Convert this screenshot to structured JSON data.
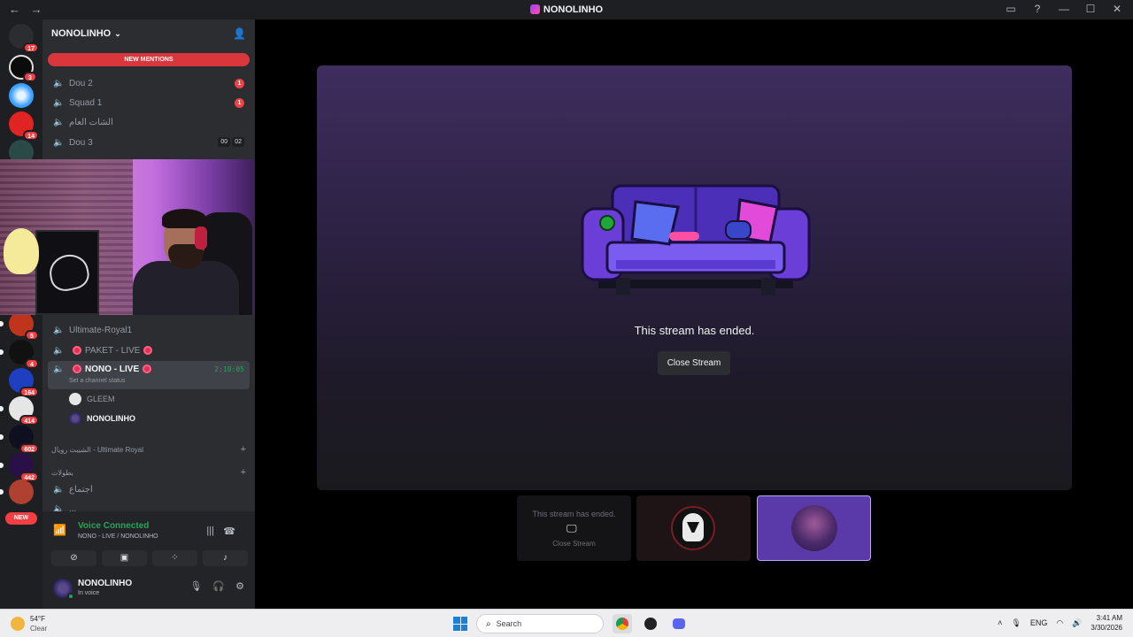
{
  "window": {
    "title": "NONOLINHO",
    "nav_back": "←",
    "nav_forward": "→",
    "icons": [
      "inbox-icon",
      "help-icon",
      "minimize-icon",
      "maximize-icon",
      "close-icon"
    ],
    "control_glyphs": [
      "▭",
      "?",
      "—",
      "☐",
      "✕"
    ]
  },
  "guilds": {
    "badges": [
      "17",
      "3",
      "",
      "14",
      "",
      "5",
      "4",
      "164",
      "414",
      "602",
      "442"
    ],
    "new_label": "NEW"
  },
  "server": {
    "name": "NONOLINHO",
    "new_mentions": "NEW MENTIONS",
    "channels": [
      {
        "name": "Dou 2",
        "badge": "1"
      },
      {
        "name": "Squad 1",
        "badge": "1"
      },
      {
        "name": "الشات العام",
        "badge": ""
      },
      {
        "name": "Dou 3",
        "tags": [
          "00",
          "02"
        ]
      }
    ],
    "voice_channels": [
      {
        "name": "Ultimate-Royal1"
      },
      {
        "name": "PAKET - LIVE"
      },
      {
        "name": "NONO - LIVE",
        "timer": "2:10:05",
        "status": "Set a channel status"
      }
    ],
    "members": [
      "GLEEM",
      "NONOLINHO"
    ],
    "categories": [
      "الشيبت رويال - Ultimate Royal",
      "بطولات"
    ],
    "more_channels": [
      "اجتماع",
      "..."
    ]
  },
  "voice": {
    "title": "Voice Connected",
    "subtitle": "NONO - LIVE / NONOLINHO"
  },
  "user": {
    "name": "NONOLINHO",
    "state": "In voice"
  },
  "stream": {
    "ended_text": "This stream has ended.",
    "close_label": "Close Stream",
    "thumb_ended": "This stream has ended.",
    "thumb_close": "Close Stream"
  },
  "taskbar": {
    "temp": "54°F",
    "condition": "Clear",
    "search_placeholder": "Search",
    "lang": "ENG",
    "time": "3:41 AM",
    "date": "3/30/2026"
  },
  "colors": {
    "accent_red": "#f23f43",
    "voice_green": "#23a559",
    "active_tile": "#5a3aa8"
  }
}
